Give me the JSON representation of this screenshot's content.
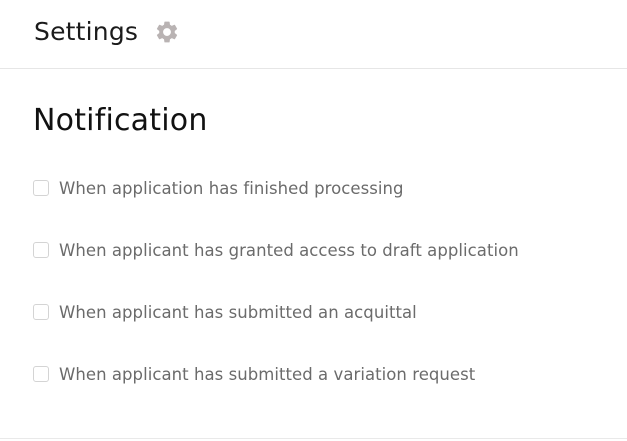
{
  "header": {
    "title": "Settings",
    "icon": "gear-icon"
  },
  "section": {
    "title": "Notification"
  },
  "notifications": [
    {
      "label": "When application has finished processing",
      "checked": false
    },
    {
      "label": "When applicant has granted access to draft application",
      "checked": false
    },
    {
      "label": "When applicant has submitted an acquittal",
      "checked": false
    },
    {
      "label": "When applicant has submitted a variation request",
      "checked": false
    }
  ],
  "colors": {
    "gear": "#b9b3b3",
    "label": "#6b6b6b",
    "checkbox_border": "#d4d4d4"
  }
}
